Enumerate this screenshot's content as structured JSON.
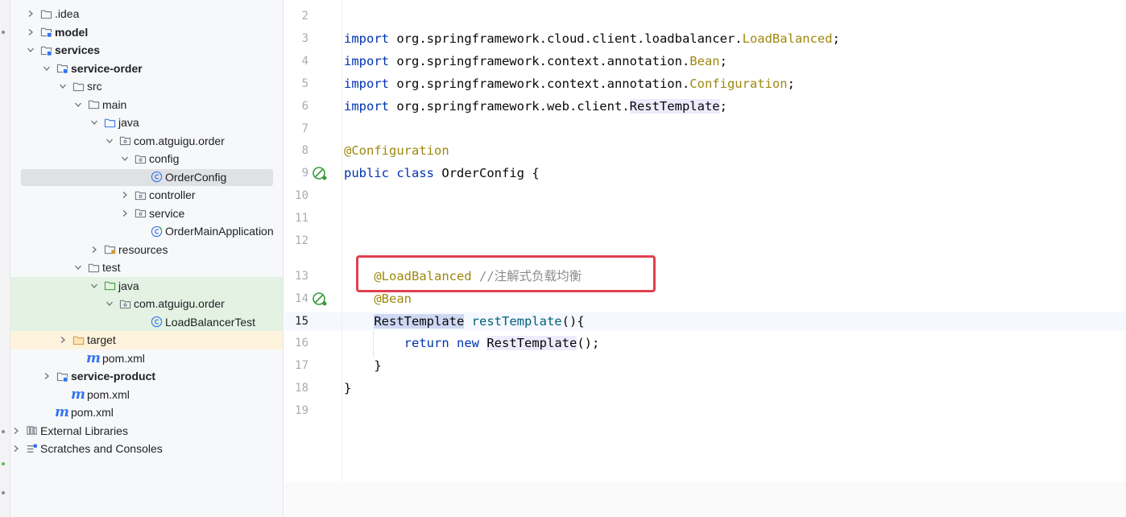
{
  "project_tree": {
    "items": [
      {
        "label": ".idea",
        "icon": "folder-icon",
        "expanded": false,
        "bold": false
      },
      {
        "label": "model",
        "icon": "module-folder-icon",
        "expanded": false,
        "bold": true
      },
      {
        "label": "services",
        "icon": "module-folder-icon",
        "expanded": true,
        "bold": true
      },
      {
        "label": "service-order",
        "icon": "module-folder-icon",
        "expanded": true,
        "bold": true
      },
      {
        "label": "src",
        "icon": "folder-icon",
        "expanded": true,
        "bold": false
      },
      {
        "label": "main",
        "icon": "folder-icon",
        "expanded": true,
        "bold": false
      },
      {
        "label": "java",
        "icon": "source-folder-icon",
        "expanded": true,
        "bold": false
      },
      {
        "label": "com.atguigu.order",
        "icon": "package-icon",
        "expanded": true,
        "bold": false
      },
      {
        "label": "config",
        "icon": "package-icon",
        "expanded": true,
        "bold": false
      },
      {
        "label": "OrderConfig",
        "icon": "class-icon",
        "expanded": null,
        "bold": false
      },
      {
        "label": "controller",
        "icon": "package-icon",
        "expanded": false,
        "bold": false
      },
      {
        "label": "service",
        "icon": "package-icon",
        "expanded": false,
        "bold": false
      },
      {
        "label": "OrderMainApplication",
        "icon": "spring-class-icon",
        "expanded": null,
        "bold": false
      },
      {
        "label": "resources",
        "icon": "resources-folder-icon",
        "expanded": false,
        "bold": false
      },
      {
        "label": "test",
        "icon": "folder-icon",
        "expanded": true,
        "bold": false
      },
      {
        "label": "java",
        "icon": "test-folder-icon",
        "expanded": true,
        "bold": false
      },
      {
        "label": "com.atguigu.order",
        "icon": "package-icon",
        "expanded": true,
        "bold": false
      },
      {
        "label": "LoadBalancerTest",
        "icon": "test-class-icon",
        "expanded": null,
        "bold": false
      },
      {
        "label": "target",
        "icon": "excluded-folder-icon",
        "expanded": false,
        "bold": false
      },
      {
        "label": "pom.xml",
        "icon": "maven-icon",
        "expanded": null,
        "bold": false
      },
      {
        "label": "service-product",
        "icon": "module-folder-icon",
        "expanded": false,
        "bold": true
      },
      {
        "label": "pom.xml",
        "icon": "maven-icon",
        "expanded": null,
        "bold": false
      },
      {
        "label": "pom.xml",
        "icon": "maven-icon",
        "expanded": null,
        "bold": false
      },
      {
        "label": "External Libraries",
        "icon": "libraries-icon",
        "expanded": false,
        "bold": false
      },
      {
        "label": "Scratches and Consoles",
        "icon": "scratches-icon",
        "expanded": false,
        "bold": false
      }
    ],
    "maven_glyph": "m"
  },
  "editor": {
    "lines": [
      {
        "no": "2",
        "text": ""
      },
      {
        "no": "3",
        "text": "import org.springframework.cloud.client.loadbalancer.LoadBalanced;"
      },
      {
        "no": "4",
        "text": "import org.springframework.context.annotation.Bean;"
      },
      {
        "no": "5",
        "text": "import org.springframework.context.annotation.Configuration;"
      },
      {
        "no": "6",
        "text": "import org.springframework.web.client.RestTemplate;"
      },
      {
        "no": "7",
        "text": ""
      },
      {
        "no": "8",
        "text": "@Configuration"
      },
      {
        "no": "9",
        "text": "public class OrderConfig {"
      },
      {
        "no": "10",
        "text": ""
      },
      {
        "no": "11",
        "text": ""
      },
      {
        "no": "12",
        "text": ""
      },
      {
        "no": "13",
        "text": "    @LoadBalanced //注解式负载均衡"
      },
      {
        "no": "14",
        "text": "    @Bean"
      },
      {
        "no": "15",
        "text": "    RestTemplate restTemplate(){"
      },
      {
        "no": "16",
        "text": "        return new RestTemplate();"
      },
      {
        "no": "17",
        "text": "    }"
      },
      {
        "no": "18",
        "text": "}"
      },
      {
        "no": "19",
        "text": ""
      }
    ],
    "tokens": {
      "import_kw": "import",
      "pkg_cloud": " org.springframework.cloud.client.loadbalancer.",
      "cls_loadbalanced": "LoadBalanced",
      "pkg_bean": " org.springframework.context.annotation.",
      "cls_bean": "Bean",
      "pkg_config": " org.springframework.context.annotation.",
      "cls_config": "Configuration",
      "pkg_web": " org.springframework.web.client.",
      "cls_resttemplate": "RestTemplate",
      "semi": ";",
      "ann_configuration": "@Configuration",
      "kw_public": "public",
      "kw_class": "class",
      "class_name": "OrderConfig",
      "open_brace": " {",
      "ann_loadbalanced": "@LoadBalanced",
      "comment": "//注解式负载均衡",
      "ann_bean": "@Bean",
      "ret_type": "RestTemplate",
      "method_name": "restTemplate",
      "method_parens": "(){",
      "kw_return": "return",
      "kw_new": "new",
      "new_type": "RestTemplate",
      "call_end": "();",
      "close_brace": "}"
    },
    "current_line": "15",
    "highlight_box_color": "#e0404f"
  },
  "colors": {
    "keyword": "#0033b3",
    "annotation": "#9e880d",
    "comment": "#8c8c8c",
    "method": "#00627a"
  }
}
